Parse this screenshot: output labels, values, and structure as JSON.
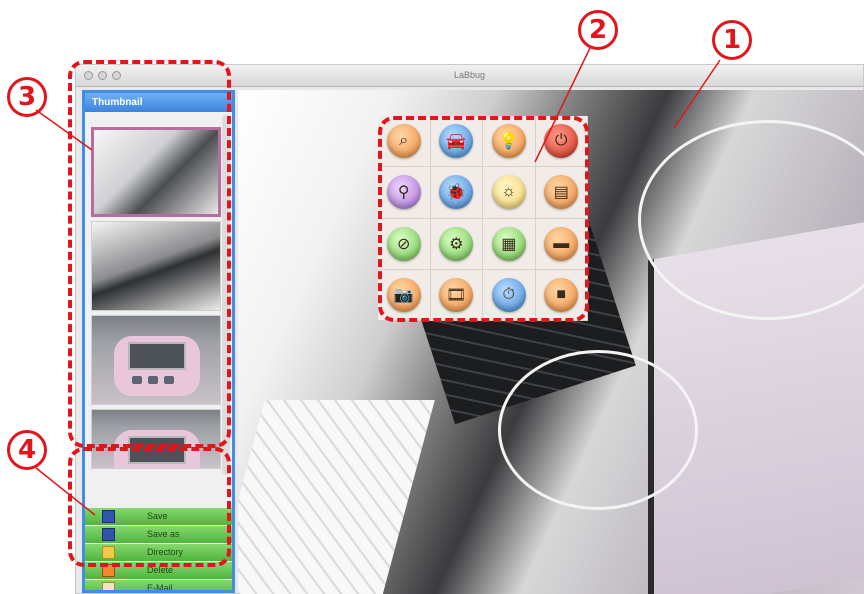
{
  "window": {
    "title": "LaBbug"
  },
  "sidebar": {
    "header": "Thumbnail",
    "thumbnails": [
      {
        "label": "thumbnail-1"
      },
      {
        "label": "thumbnail-2"
      },
      {
        "label": "thumbnail-3"
      },
      {
        "label": "thumbnail-4"
      }
    ],
    "menu": [
      {
        "label": "Save",
        "icon": "floppy-disk-icon"
      },
      {
        "label": "Save as",
        "icon": "floppy-disk-icon"
      },
      {
        "label": "Directory",
        "icon": "folder-icon"
      },
      {
        "label": "Delete",
        "icon": "trash-icon"
      },
      {
        "label": "E-Mail",
        "icon": "mail-icon"
      }
    ]
  },
  "controls": [
    {
      "icon": "magnify-icon",
      "glyph": "⌕"
    },
    {
      "icon": "car-icon",
      "glyph": "🚘"
    },
    {
      "icon": "lightbulb-icon",
      "glyph": "💡"
    },
    {
      "icon": "power-icon",
      "glyph": "⏻"
    },
    {
      "icon": "pin-icon",
      "glyph": "⚲"
    },
    {
      "icon": "ladybug-icon",
      "glyph": "🐞"
    },
    {
      "icon": "sun-icon",
      "glyph": "☼"
    },
    {
      "icon": "clipboard-icon",
      "glyph": "▤"
    },
    {
      "icon": "no-edit-icon",
      "glyph": "⊘"
    },
    {
      "icon": "gear-icon",
      "glyph": "⚙"
    },
    {
      "icon": "note-icon",
      "glyph": "▦"
    },
    {
      "icon": "window-icon",
      "glyph": "▬"
    },
    {
      "icon": "camera-icon",
      "glyph": "📷"
    },
    {
      "icon": "filmstrip-icon",
      "glyph": "🎞"
    },
    {
      "icon": "timer-icon",
      "glyph": "⏱"
    },
    {
      "icon": "stop-icon",
      "glyph": "■"
    }
  ],
  "annotations": [
    "①",
    "②",
    "③",
    "④"
  ]
}
